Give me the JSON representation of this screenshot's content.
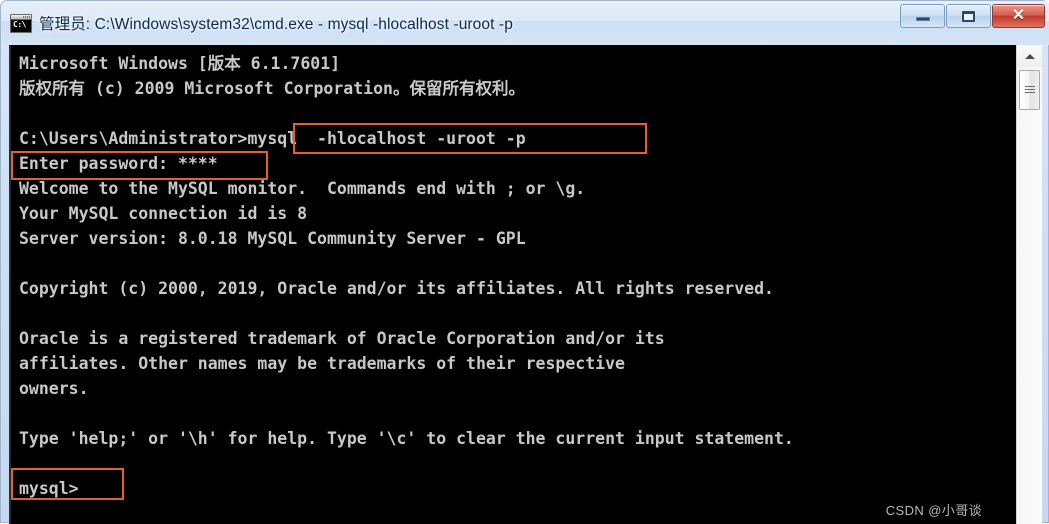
{
  "window": {
    "title": "管理员: C:\\Windows\\system32\\cmd.exe - mysql  -hlocalhost -uroot -p",
    "icon": "cmd-icon",
    "icon_text": "C:\\",
    "buttons": {
      "minimize_label": "—",
      "maximize_label": "□",
      "close_label": "✕"
    }
  },
  "console": {
    "lines": [
      "Microsoft Windows [版本 6.1.7601]",
      "版权所有 (c) 2009 Microsoft Corporation。保留所有权利。",
      "",
      "C:\\Users\\Administrator>mysql  -hlocalhost -uroot -p",
      "Enter password: ****",
      "Welcome to the MySQL monitor.  Commands end with ; or \\g.",
      "Your MySQL connection id is 8",
      "Server version: 8.0.18 MySQL Community Server - GPL",
      "",
      "Copyright (c) 2000, 2019, Oracle and/or its affiliates. All rights reserved.",
      "",
      "Oracle is a registered trademark of Oracle Corporation and/or its",
      "affiliates. Other names may be trademarks of their respective",
      "owners.",
      "",
      "Type 'help;' or '\\h' for help. Type '\\c' to clear the current input statement.",
      "",
      "mysql>"
    ]
  },
  "annotations": {
    "color": "#e2622a",
    "boxes": [
      {
        "id": "box-cmd",
        "target": "mysql  -hlocalhost -uroot -p"
      },
      {
        "id": "box-pwd",
        "target": "Enter password: ****"
      },
      {
        "id": "box-prompt",
        "target": "mysql>"
      }
    ]
  },
  "scrollbar": {
    "up_arrow": "scroll-up-arrow",
    "thumb_position": "top"
  },
  "watermark": {
    "text": "CSDN @小哥谈"
  }
}
